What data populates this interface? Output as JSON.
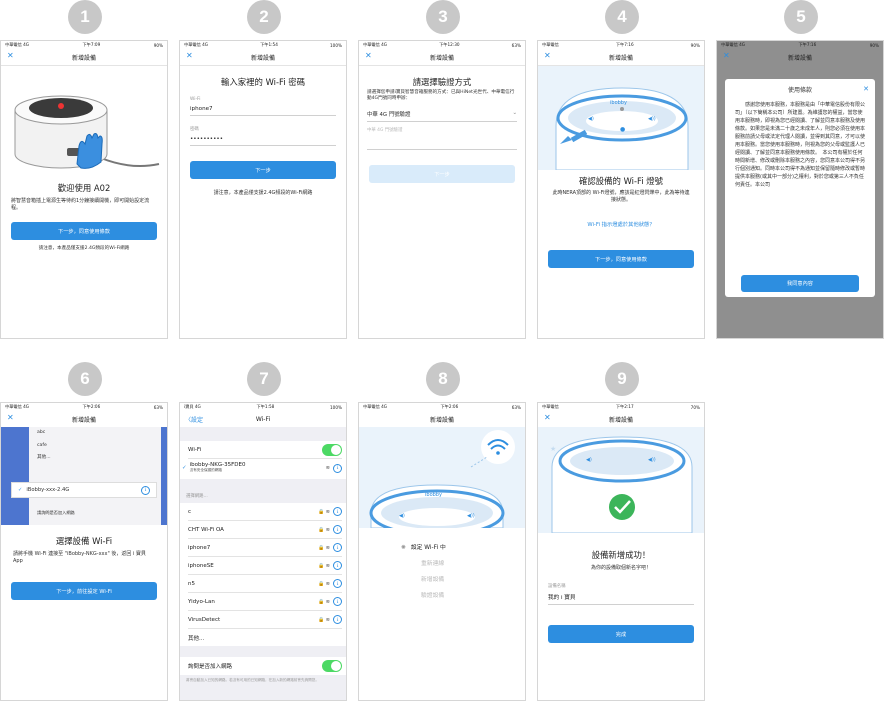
{
  "badges": [
    "1",
    "2",
    "3",
    "4",
    "5",
    "6",
    "7",
    "8",
    "9"
  ],
  "common": {
    "nav_title": "新增設備",
    "wifi_label": "Wi-Fi",
    "password_label": "密碼",
    "time": "下午"
  },
  "s1": {
    "carrier": "中華電信 4G",
    "time": "下午7:09",
    "battery": "90%",
    "title": "歡迎使用 A02",
    "text": "將智慧音箱插上電源生等待約1分鐘接續開機，即可開始設定流程。",
    "button": "下一步，同意使用條款",
    "note": "請注意，本產品僅支援2.4G頻段的Wi-Fi網路"
  },
  "s2": {
    "carrier": "中華電信 4G",
    "time": "下午1:54",
    "battery": "100%",
    "title": "輸入家裡的 Wi-Fi 密碼",
    "wifi_value": "iphone7",
    "password_value": "••••••••••",
    "button": "下一步",
    "note": "請注意，本產品僅支援2.4G頻段的Wi-Fi網路"
  },
  "s3": {
    "carrier": "中華電信 4G",
    "time": "下午12:30",
    "battery": "63%",
    "title": "請選擇驗證方式",
    "text": "請選擇您申請i寶貝智慧音箱服務的方式：已與HiNet光世代、中華電信行動4G門號同時申辦：",
    "select": "中華 4G 門號驗證",
    "input_placeholder": "中華 4G 門號驗證",
    "button": "下一步"
  },
  "s4": {
    "carrier": "中華電信",
    "time": "下午7:16",
    "battery": "90%",
    "title": "確認設備的 Wi-Fi 燈號",
    "text": "此時NERA頂部的 Wi-Fi燈號，應該是紅燈閃爍中，此為等待連接狀態。",
    "link": "Wi-Fi 指示燈處於其他狀態？",
    "button": "下一步，同意使用條款",
    "brand": "ibobby"
  },
  "s5": {
    "carrier": "中華電信 4G",
    "time": "下午7:16",
    "battery": "90%",
    "modal_title": "使用條款",
    "terms": "感謝您使用本服務，本服務是由「中華電信股份有限公司」（以下簡稱本公司）所建置。為維護您的權益，當您使用本服務時，即視為您已經閱讀、了解並同意本服務及使用條款。如果您是未滿二十歲之未成年人，則您必須在使用本服務前請父母或法定代理人閱讀，並得到其同意，才可以使用本服務。當您使用本服務時，則視為您的父母或監護人已經閱讀、了解並同意本服務使用條款。　本公司有權於任何時間新增、修改或刪除本服務之內容，您同意本公司得不另行個別通知。同時本公司得不為通知並保留隨時修改或暫時提供本服務(或其中一部分)之權利，對於您或第三人不負任何責任。本公司",
    "button": "我同意內容"
  },
  "s6": {
    "carrier": "中華電信 4G",
    "time": "下午2:06",
    "battery": "63%",
    "wifi_list": [
      "abc",
      "cafe",
      "其他..."
    ],
    "selected": "iBobby-xxx-2.4G",
    "join_label": "請詢問是否加入網路",
    "title": "選擇設備 Wi-Fi",
    "text": "請將手機 Wi-Fi 連接至 \"iBobby-NKG-xxx\" 後，返回 i 寶貝 App",
    "button": "下一步，前往設定 Wi-Fi"
  },
  "s7": {
    "carrier": "i寶貝 4G",
    "time": "下午1:58",
    "battery": "100%",
    "back": "設定",
    "nav_title": "Wi-Fi",
    "wifi_label": "Wi-Fi",
    "connected": "ibobby-NKG-35FDE0",
    "connected_sub": "沒有安全保護的網路",
    "section": "選擇網路...",
    "networks": [
      "c",
      "CHT Wi-Fi OA",
      "iphone7",
      "iphoneSE",
      "n5",
      "Yidyo-Lan",
      "VirusDetect",
      "其他..."
    ],
    "ask_label": "詢問是否加入網路",
    "ask_desc": "將會自動加入已知的網路。若沒有可用的已知網路，在加入新的網路前會先詢問您。"
  },
  "s8": {
    "carrier": "中華電信 4G",
    "time": "下午2:06",
    "battery": "63%",
    "brand": "ibobby",
    "steps": [
      "設定 Wi-Fi 中",
      "重新連線",
      "新增設備",
      "驗證設備"
    ]
  },
  "s9": {
    "carrier": "中華電信",
    "time": "下午2:17",
    "battery": "70%",
    "title": "設備新增成功！",
    "subtitle": "為你的設備取個新名字吧！",
    "name_label": "設備名稱",
    "name_value": "我的 i 寶貝",
    "button": "完成"
  },
  "colors": {
    "primary": "#2d8ee0",
    "badge": "#c8c8c8",
    "toggle": "#4cd964"
  }
}
